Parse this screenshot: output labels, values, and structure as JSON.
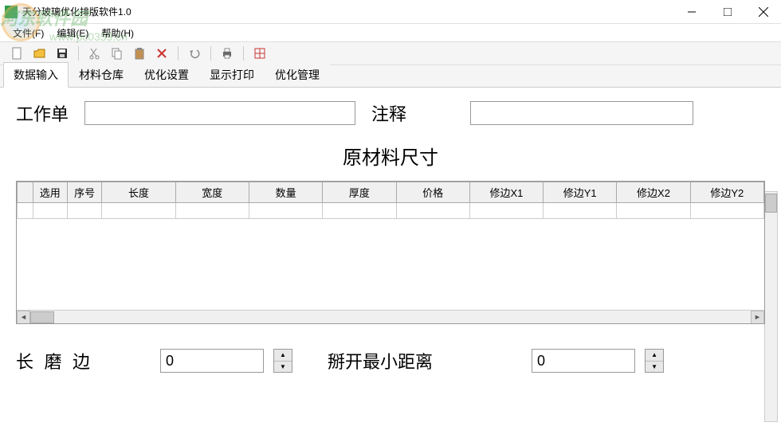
{
  "window": {
    "title": "天分玻璃优化排版软件1.0"
  },
  "watermark": {
    "text": "河东软件园",
    "url": "www.pc0359.cn"
  },
  "menu": {
    "file": "文件(F)",
    "edit": "编辑(E)",
    "help": "帮助(H)"
  },
  "tabs": {
    "t1": "数据输入",
    "t2": "材料仓库",
    "t3": "优化设置",
    "t4": "显示打印",
    "t5": "优化管理"
  },
  "form": {
    "worksheet_label": "工作单",
    "worksheet_value": "",
    "note_label": "注释",
    "note_value": ""
  },
  "section": {
    "material_size": "原材料尺寸"
  },
  "table": {
    "headers": {
      "h0": "",
      "h1": "选用",
      "h2": "序号",
      "h3": "长度",
      "h4": "宽度",
      "h5": "数量",
      "h6": "厚度",
      "h7": "价格",
      "h8": "修边X1",
      "h9": "修边Y1",
      "h10": "修边X2",
      "h11": "修边Y2"
    }
  },
  "bottom": {
    "grind_label": "长 磨 边",
    "grind_value": "0",
    "min_dist_label": "掰开最小距离",
    "min_dist_value": "0"
  }
}
